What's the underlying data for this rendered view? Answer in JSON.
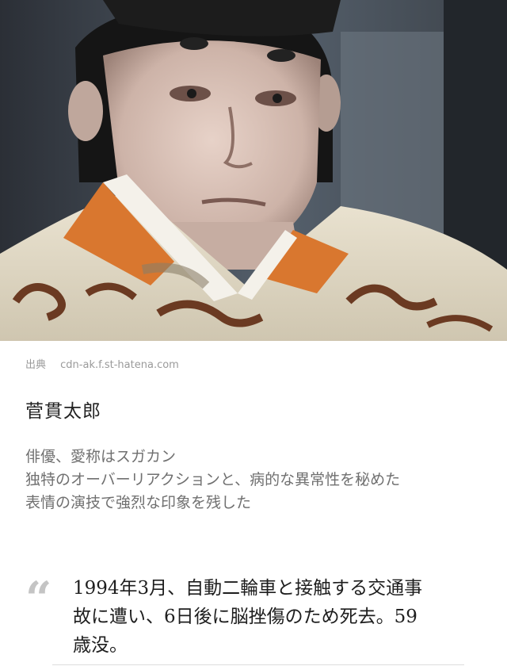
{
  "source": {
    "label": "出典",
    "domain": "cdn-ak.f.st-hatena.com"
  },
  "person": {
    "name": "菅貫太郎"
  },
  "description": {
    "lines": [
      "俳優、愛称はスガカン",
      "独特のオーバーリアクションと、病的な異常性を秘めた",
      "表情の演技で強烈な印象を残した"
    ]
  },
  "quote": {
    "mark": "“",
    "lines": [
      "1994年3月、自動二輪車と接触する交通事",
      "故に遭い、6日後に脳挫傷のため死去。59",
      "歳没。"
    ]
  },
  "colors": {
    "photo_background": "#3a3f47",
    "costume_orange": "#d9772f",
    "costume_cream": "#e8e0cc",
    "pattern_brown": "#6b3a22"
  }
}
